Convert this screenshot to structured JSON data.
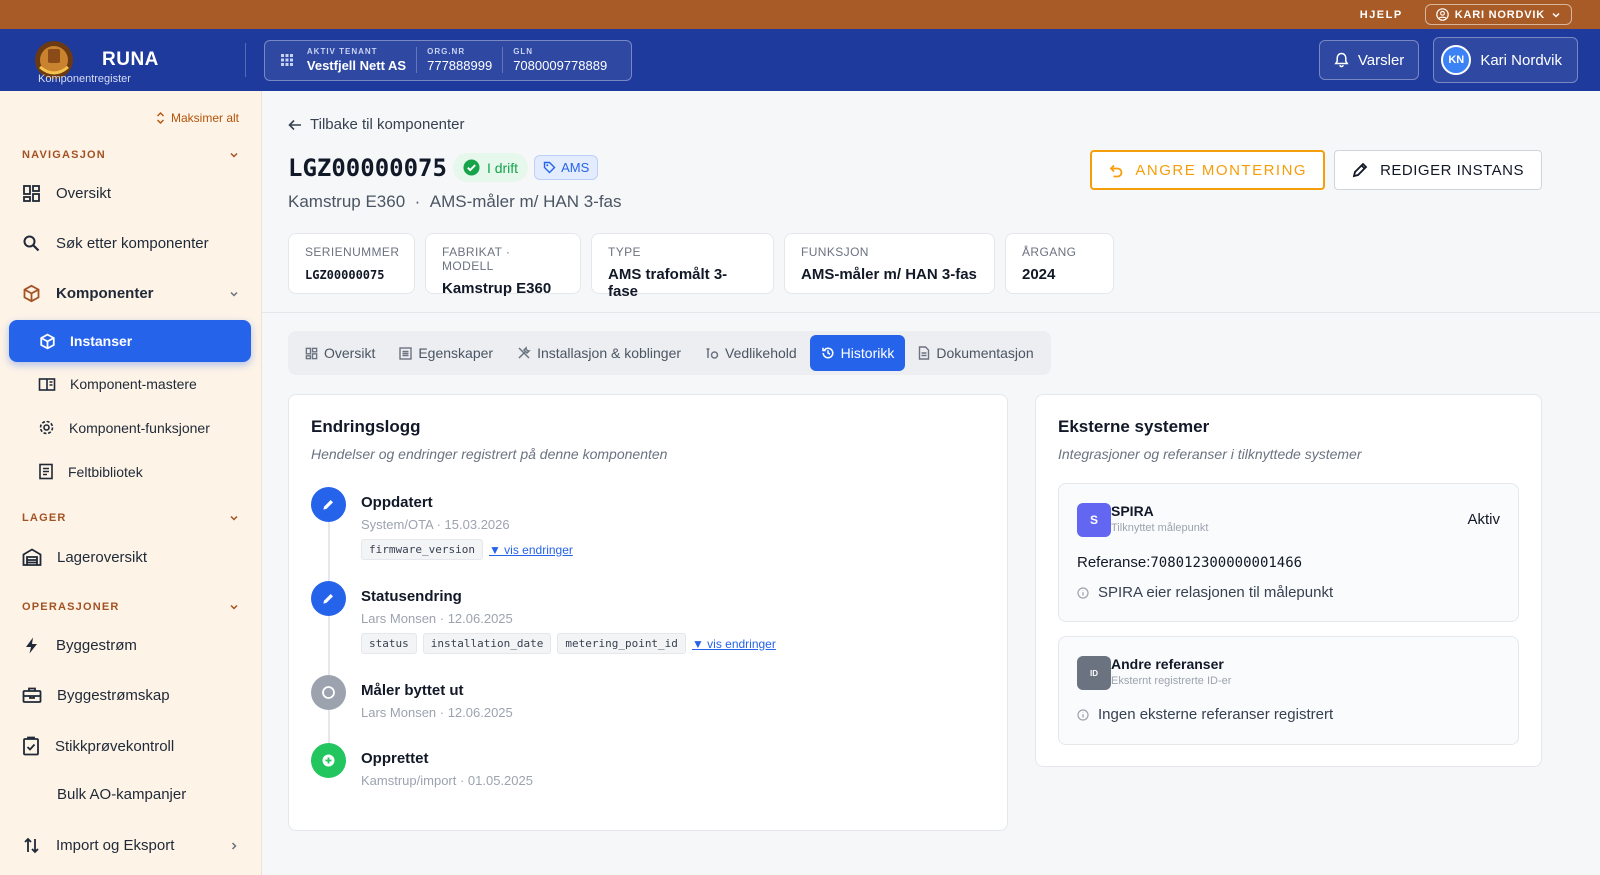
{
  "topbar": {
    "help": "HJELP",
    "user": "KARI NORDVIK"
  },
  "header": {
    "brand": "RUNA",
    "brand_sub": "Komponentregister",
    "tenant_label": "AKTIV TENANT",
    "tenant_value": "Vestfjell Nett AS",
    "org_label": "ORG.NR",
    "org_value": "777888999",
    "gln_label": "GLN",
    "gln_value": "7080009778889",
    "alerts": "Varsler",
    "user_initials": "KN",
    "user_name": "Kari Nordvik"
  },
  "sidebar": {
    "maximize": "Maksimer alt",
    "sections": {
      "nav": "NAVIGASJON",
      "lager": "LAGER",
      "ops": "OPERASJONER"
    },
    "items": {
      "oversikt": "Oversikt",
      "sok": "Søk etter komponenter",
      "komponenter": "Komponenter",
      "instanser": "Instanser",
      "mastere": "Komponent-mastere",
      "funksjoner": "Komponent-funksjoner",
      "feltbibliotek": "Feltbibliotek",
      "lageroversikt": "Lageroversikt",
      "byggestrom": "Byggestrøm",
      "byggestromskap": "Byggestrømskap",
      "stikkprove": "Stikkprøvekontroll",
      "bulk": "Bulk AO-kampanjer",
      "import": "Import og Eksport"
    }
  },
  "page": {
    "back": "Tilbake til komponenter",
    "serial": "LGZ00000075",
    "status": "I drift",
    "tag": "AMS",
    "model": "Kamstrup E360",
    "sep": "·",
    "function": "AMS-måler m/ HAN 3-fas",
    "undo": "ANGRE MONTERING",
    "edit": "REDIGER INSTANS",
    "facts": [
      {
        "k": "SERIENUMMER",
        "v": "LGZ00000075"
      },
      {
        "k": "FABRIKAT · MODELL",
        "v": "Kamstrup E360"
      },
      {
        "k": "TYPE",
        "v": "AMS trafomålt 3-fase"
      },
      {
        "k": "FUNKSJON",
        "v": "AMS-måler m/ HAN 3-fas"
      },
      {
        "k": "ÅRGANG",
        "v": "2024"
      }
    ],
    "tabs": [
      "Oversikt",
      "Egenskaper",
      "Installasjon & koblinger",
      "Vedlikehold",
      "Historikk",
      "Dokumentasjon"
    ]
  },
  "log": {
    "title": "Endringslogg",
    "desc": "Hendelser og endringer registrert på denne komponenten",
    "events": [
      {
        "title": "Oppdatert",
        "meta": "System/OTA · 15.03.2026",
        "chips": [
          "firmware_version"
        ],
        "link": "▼ vis endringer"
      },
      {
        "title": "Statusendring",
        "meta": "Lars Monsen · 12.06.2025",
        "chips": [
          "status",
          "installation_date",
          "metering_point_id"
        ],
        "link": "▼ vis endringer"
      },
      {
        "title": "Måler byttet ut",
        "meta": "Lars Monsen · 12.06.2025"
      },
      {
        "title": "Opprettet",
        "meta": "Kamstrup/import · 01.05.2025"
      }
    ]
  },
  "external": {
    "title": "Eksterne systemer",
    "desc": "Integrasjoner og referanser i tilknyttede systemer",
    "spira": {
      "icon": "S",
      "name": "SPIRA",
      "sub": "Tilknyttet målepunkt",
      "status": "Aktiv",
      "ref_label": "Referanse:",
      "ref_value": "708012300000001466",
      "info": "SPIRA eier relasjonen til målepunkt"
    },
    "other": {
      "icon": "ID",
      "name": "Andre referanser",
      "sub": "Eksternt registrerte ID-er",
      "info": "Ingen eksterne referanser registrert"
    }
  },
  "colors": {
    "header": "#1e3a9c",
    "topbar": "#a85b27",
    "accent": "#2563eb",
    "warning": "#f59e0b",
    "success": "#16a34a",
    "sidebar": "#fdf3e7"
  }
}
